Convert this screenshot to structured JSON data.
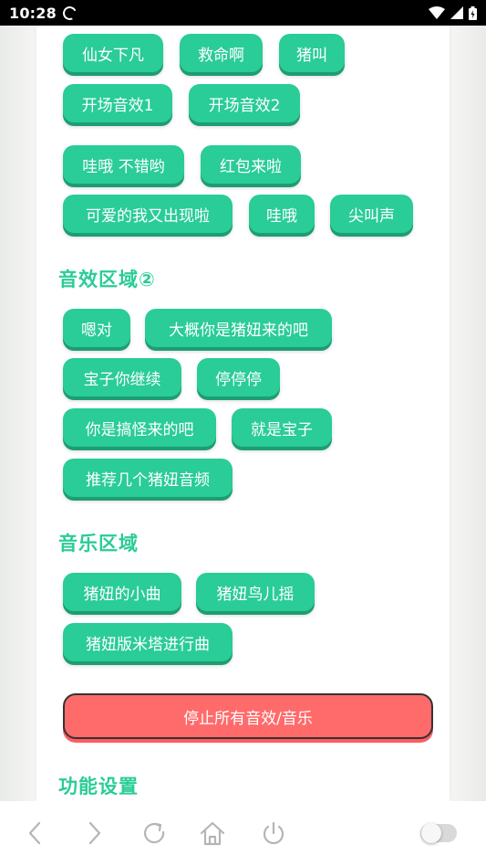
{
  "status_bar": {
    "time": "10:28"
  },
  "section1": {
    "buttons": [
      "仙女下凡",
      "救命啊",
      "猪叫",
      "开场音效1",
      "开场音效2",
      "哇哦 不错哟",
      "红包来啦",
      "可爱的我又出现啦",
      "哇哦",
      "尖叫声"
    ]
  },
  "section2": {
    "title": "音效区域②",
    "buttons": [
      "嗯对",
      "大概你是猪妞来的吧",
      "宝子你继续",
      "停停停",
      "你是搞怪来的吧",
      "就是宝子",
      "推荐几个猪妞音频"
    ]
  },
  "section3": {
    "title": "音乐区域",
    "buttons": [
      "猪妞的小曲",
      "猪妞鸟儿摇",
      "猪妞版米塔进行曲"
    ]
  },
  "stop_label": "停止所有音效/音乐",
  "section4": {
    "title": "功能设置"
  },
  "colors": {
    "accent": "#2acc97",
    "stop": "#ff6b6b"
  },
  "bottom_nav": {
    "icons": [
      "back-icon",
      "forward-icon",
      "refresh-icon",
      "home-icon",
      "power-icon",
      "toggle-switch"
    ]
  }
}
